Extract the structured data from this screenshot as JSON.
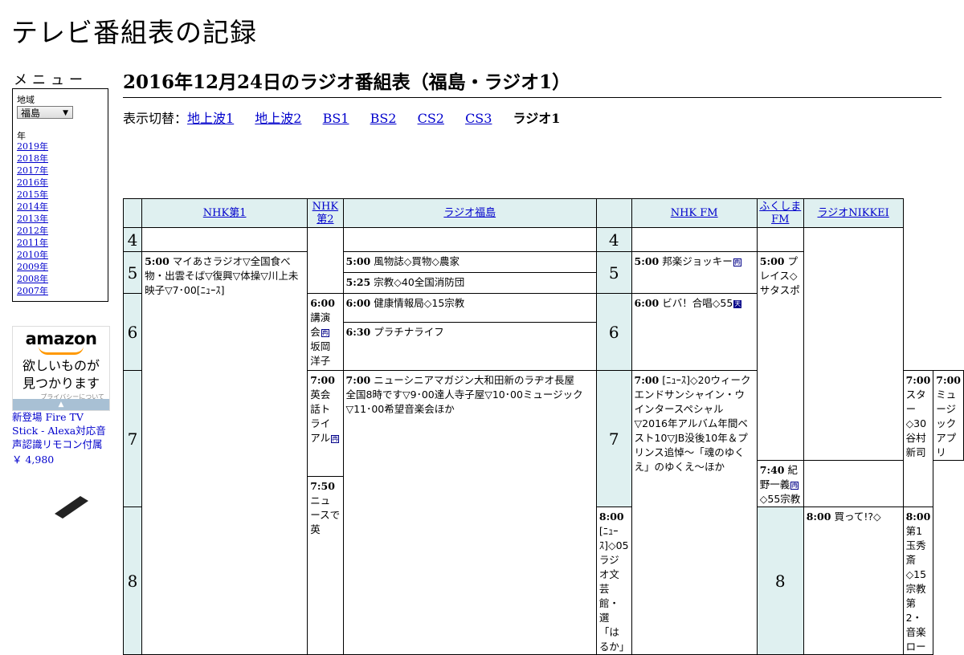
{
  "site": {
    "title": "テレビ番組表の記録"
  },
  "menu": {
    "title": "メニュー",
    "region_label": "地域",
    "region_value": "福島",
    "year_label": "年",
    "years": [
      "2019年",
      "2018年",
      "2017年",
      "2016年",
      "2015年",
      "2014年",
      "2013年",
      "2012年",
      "2011年",
      "2010年",
      "2009年",
      "2008年",
      "2007年"
    ]
  },
  "ad": {
    "brand": "amazon",
    "tagline_1": "欲しいものが",
    "tagline_2": "見つかります",
    "privacy": "プライバシーについて",
    "bar": "▲",
    "product": "新登場 Fire TV Stick - Alexa対応音声認識リモコン付属",
    "price": "￥ 4,980"
  },
  "page": {
    "title": "2016年12月24日のラジオ番組表（福島・ラジオ1）"
  },
  "switcher": {
    "label": "表示切替：",
    "links": [
      "地上波1",
      "地上波2",
      "BS1",
      "BS2",
      "CS2",
      "CS3"
    ],
    "current": "ラジオ1"
  },
  "channels": [
    "NHK第1",
    "NHK第2",
    "ラジオ福島",
    "NHK FM",
    "ふくしまFM",
    "ラジオNIKKEI"
  ],
  "hours": [
    "4",
    "5",
    "6",
    "7",
    "8"
  ],
  "programs": {
    "nhk1_0500": {
      "time": "5:00",
      "title": "マイあさラジオ▽全国食べ物・出雲そば▽復興▽体操▽川上未映子▽7･00[ﾆｭｰｽ]"
    },
    "nhk1_0800": {
      "time": "8:00",
      "title": "[ﾆｭｰｽ]◇05ラジオ文芸館・選「はるか」"
    },
    "nhk2_0600": {
      "time": "6:00",
      "title": "講演会",
      "title2": "坂岡洋子"
    },
    "nhk2_0700": {
      "time": "7:00",
      "title": "英会話トライアル"
    },
    "nhk2_0750": {
      "time": "7:50",
      "title": "ニュースで英"
    },
    "rf_0500": {
      "time": "5:00",
      "title": "風物誌◇買物◇農家"
    },
    "rf_0525": {
      "time": "5:25",
      "title": "宗教◇40全国消防団"
    },
    "rf_0600": {
      "time": "6:00",
      "title": "健康情報局◇15宗教"
    },
    "rf_0630": {
      "time": "6:30",
      "title": "プラチナライフ"
    },
    "rf_0700": {
      "time": "7:00",
      "title": "ニューシニアマガジン大和田新のラヂオ長屋　全国8時です▽9･00達人寺子屋▽10･00ミュージック▽11･00希望音楽会ほか"
    },
    "fm_0500": {
      "time": "5:00",
      "title": "邦楽ジョッキー"
    },
    "fm_0600": {
      "time": "6:00",
      "title": "ビバ！合唱◇55"
    },
    "fm_0700": {
      "time": "7:00",
      "title": "[ﾆｭｰｽ]◇20ウィークエンドサンシャイン・ウインタースペシャル▽2016年アルバム年間ベスト10▽JB没後10年＆プリンス追悼〜「魂のゆくえ」のゆくえ〜ほか"
    },
    "ffm_0500": {
      "time": "5:00",
      "title": "プレイス◇サタスポ"
    },
    "ffm_0700": {
      "time": "7:00",
      "title": "スター◇30谷村新司"
    },
    "ffm_0800": {
      "time": "8:00",
      "title": "買って!?◇"
    },
    "nk_0700": {
      "time": "7:00",
      "title": "ミュージックアプリ"
    },
    "nk_0740": {
      "time": "7:40",
      "title": "紀野一義",
      "title2": "◇55宗教"
    },
    "nk_0800": {
      "time": "8:00",
      "title": "第1玉秀斎◇15宗教第2・音楽ロー"
    }
  },
  "marks": {
    "re": "再",
    "ten": "天"
  },
  "colors": {
    "header_bg": "#dff0f0",
    "link": "#0000cc"
  }
}
